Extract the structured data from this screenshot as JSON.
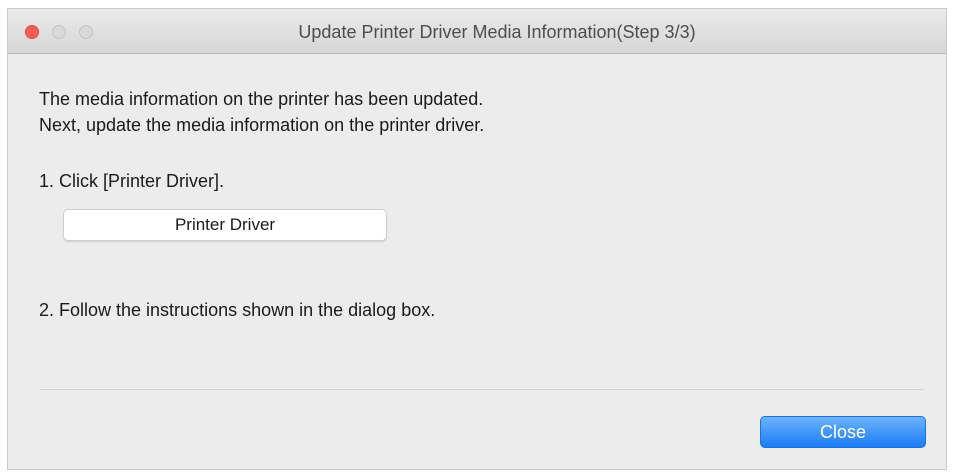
{
  "window": {
    "title": "Update Printer Driver Media Information(Step 3/3)"
  },
  "message": {
    "line1": "The media information on the printer has been updated.",
    "line2": "Next, update the media information on the printer driver."
  },
  "steps": {
    "step1": "1. Click [Printer Driver].",
    "printer_driver_button": "Printer Driver",
    "step2": "2. Follow the instructions shown in the dialog box."
  },
  "footer": {
    "close_button": "Close"
  },
  "colors": {
    "close_traffic_light": "#fc5f57",
    "primary_button": "#1b7cf5"
  }
}
